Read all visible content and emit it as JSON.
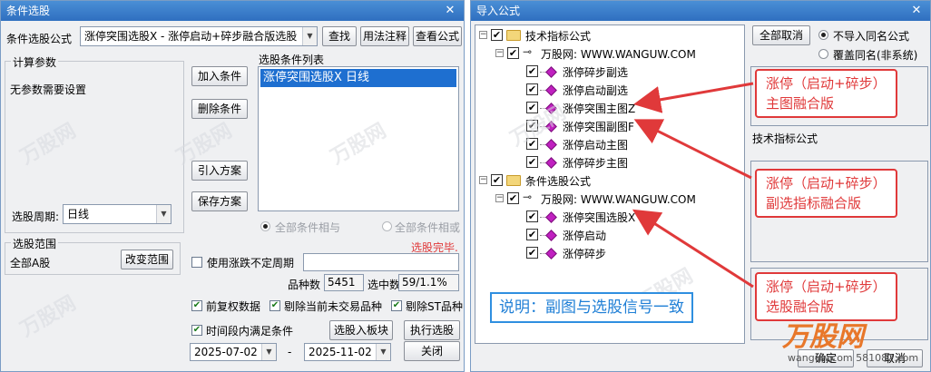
{
  "left": {
    "title": "条件选股",
    "formula_label": "条件选股公式",
    "formula_value": "涨停突围选股X - 涨停启动+碎步融合版选股",
    "btn_find": "查找",
    "btn_usage": "用法注释",
    "btn_view": "查看公式",
    "params_group": "计算参数",
    "params_text": "无参数需要设置",
    "list_label": "选股条件列表",
    "list_items": [
      "涨停突围选股X  日线"
    ],
    "btn_add": "加入条件",
    "btn_delete": "删除条件",
    "btn_import": "引入方案",
    "btn_save": "保存方案",
    "period_label": "选股周期:",
    "period_value": "日线",
    "radio_and": "全部条件相与",
    "radio_or": "全部条件相或",
    "status": "选股完毕.",
    "range_group": "选股范围",
    "range_value": "全部A股",
    "btn_change_range": "改变范围",
    "use_period_label": "使用涨跌不定周期",
    "count_label": "品种数",
    "count_value": "5451",
    "selected_label": "选中数",
    "selected_value": "59/1.1%",
    "cb_restore": "前复权数据",
    "cb_exclude_untraded": "剔除当前未交易品种",
    "cb_exclude_st": "剔除ST品种",
    "cb_time_range": "时间段内满足条件",
    "btn_to_block": "选股入板块",
    "btn_execute": "执行选股",
    "date_start": "2025-07-02",
    "date_sep": "-",
    "date_end": "2025-11-02",
    "btn_close": "关闭"
  },
  "right": {
    "title": "导入公式",
    "btn_cancel_all": "全部取消",
    "radio_no_import": "不导入同名公式",
    "radio_overwrite": "覆盖同名(非系统)",
    "section_label": "技术指标公式",
    "btn_ok": "确定",
    "btn_cancel": "取消",
    "tree": {
      "root1": "技术指标公式",
      "root1_child": "万股网: WWW.WANGUW.COM",
      "root1_items": [
        "涨停碎步副选",
        "涨停启动副选",
        "涨停突围主图Z",
        "涨停突围副图F",
        "涨停启动主图",
        "涨停碎步主图"
      ],
      "root2": "条件选股公式",
      "root2_child": "万股网: WWW.WANGUW.COM",
      "root2_items": [
        "涨停突围选股X",
        "涨停启动",
        "涨停碎步"
      ]
    }
  },
  "callouts": {
    "c1_line1": "涨停（启动+碎步）",
    "c1_line2": "主图融合版",
    "c2_line1": "涨停（启动+碎步）",
    "c2_line2": "副选指标融合版",
    "c3_line1": "涨停（启动+碎步）",
    "c3_line2": "选股融合版",
    "note": "说明：副图与选股信号一致"
  },
  "brand": {
    "name": "万股网",
    "url": "wanguw.com 581082.com"
  },
  "colors": {
    "title_blue": "#2f6fc0",
    "callout_red": "#e0393a",
    "note_blue": "#2f8fe0",
    "list_selected": "#1e6fd0",
    "brand_orange": "#e8772a"
  },
  "icons": [
    "close-icon",
    "chevron-down-icon",
    "folder-icon",
    "key-icon",
    "formula-diamond-icon",
    "checkbox-icon"
  ]
}
